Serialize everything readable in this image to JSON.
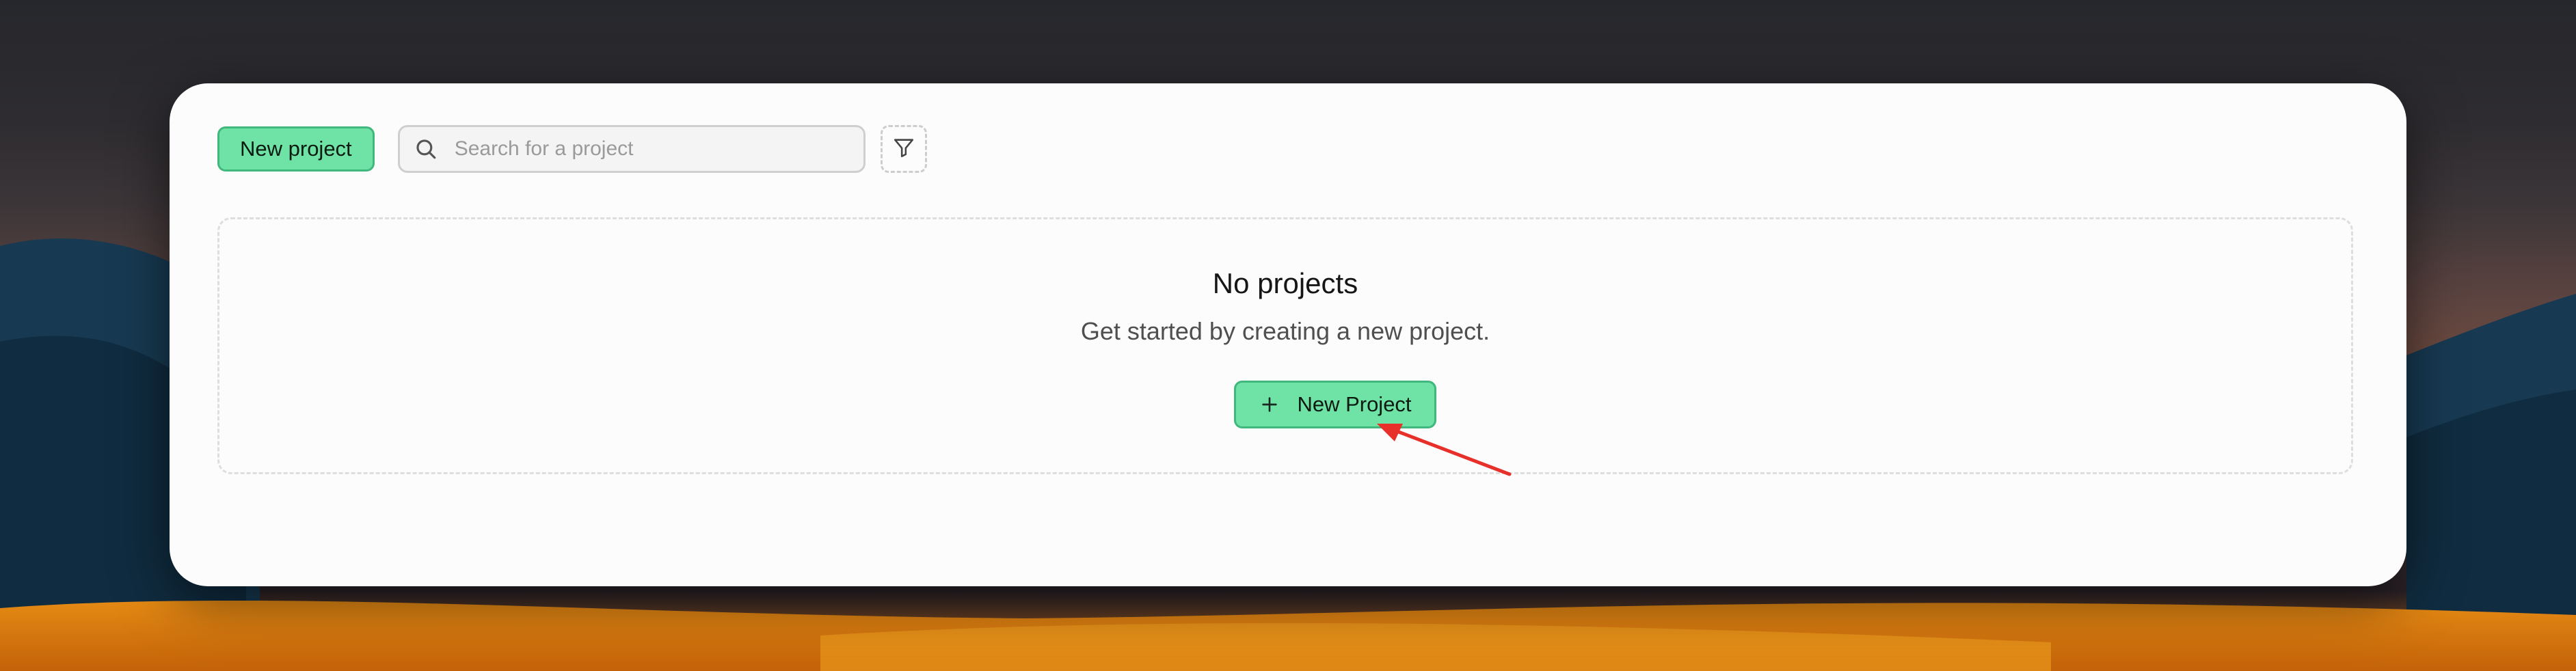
{
  "toolbar": {
    "new_project_label": "New project",
    "search_placeholder": "Search for a project",
    "search_icon": "search-icon",
    "filter_icon": "filter-icon"
  },
  "empty_state": {
    "title": "No projects",
    "subtitle": "Get started by creating a new project.",
    "button_label": "New Project",
    "button_icon": "plus-icon"
  },
  "colors": {
    "accent": "#6ee3a5",
    "accent_border": "#3fb77d",
    "annotation_arrow": "#e8302a"
  }
}
